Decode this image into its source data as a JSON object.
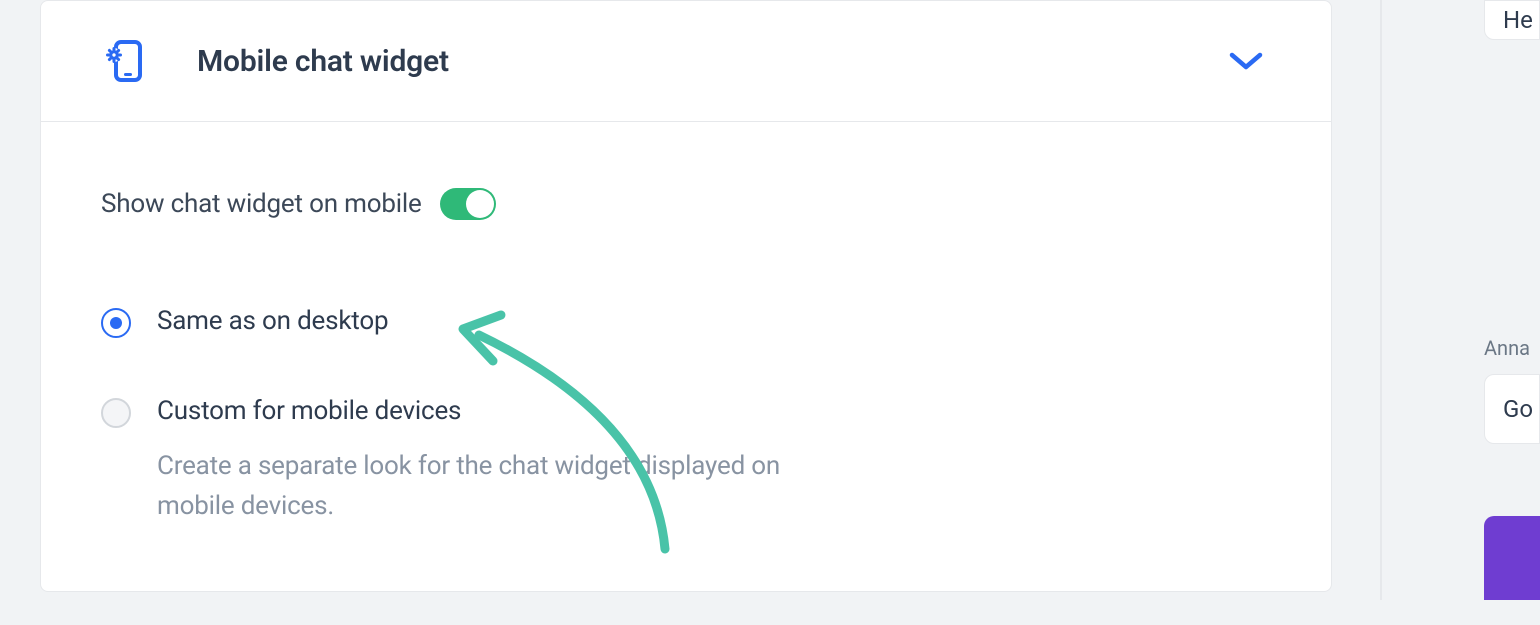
{
  "panel": {
    "title": "Mobile chat widget",
    "toggle": {
      "label": "Show chat widget on mobile",
      "value": true
    },
    "radios": [
      {
        "label": "Same as on desktop",
        "selected": true
      },
      {
        "label": "Custom for mobile devices",
        "description": "Create a separate look for the chat widget displayed on mobile devices.",
        "selected": false
      }
    ]
  },
  "rightSide": {
    "topText": "He",
    "nameLabel": "Anna",
    "midText": "Go"
  }
}
